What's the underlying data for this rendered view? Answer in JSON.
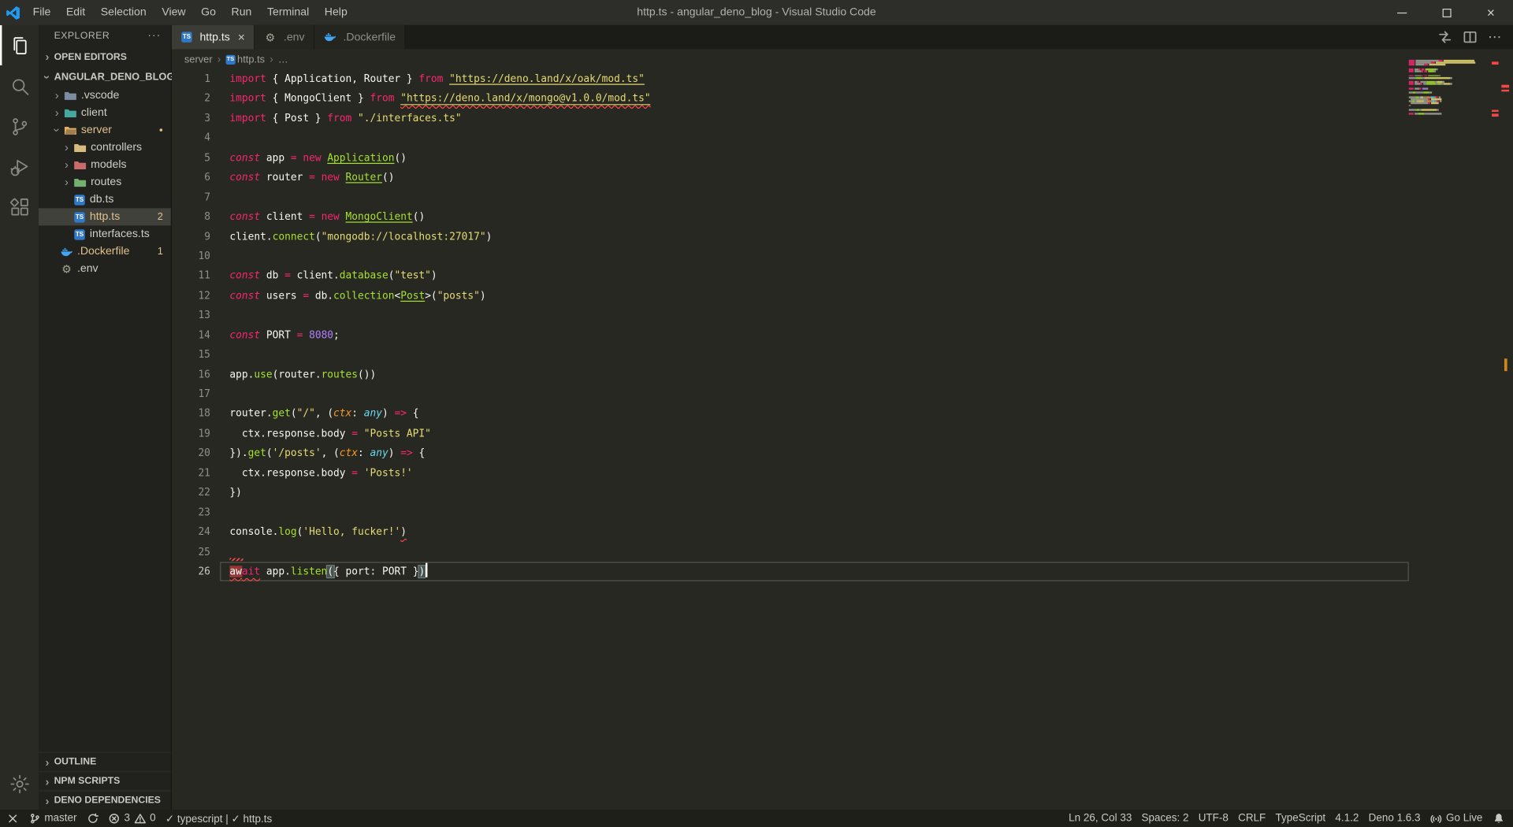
{
  "title_bar": {
    "menus": [
      "File",
      "Edit",
      "Selection",
      "View",
      "Go",
      "Run",
      "Terminal",
      "Help"
    ],
    "title": "http.ts - angular_deno_blog - Visual Studio Code",
    "window_controls": [
      "minimize",
      "maximize",
      "close"
    ]
  },
  "activity_bar": {
    "items": [
      {
        "name": "explorer",
        "active": true
      },
      {
        "name": "search",
        "active": false
      },
      {
        "name": "source-control",
        "active": false
      },
      {
        "name": "run-debug",
        "active": false
      },
      {
        "name": "extensions",
        "active": false
      }
    ],
    "bottom": [
      {
        "name": "settings",
        "active": false
      }
    ]
  },
  "explorer": {
    "title": "EXPLORER",
    "open_editors_label": "OPEN EDITORS",
    "workspace_label": "ANGULAR_DENO_BLOG",
    "tree": [
      {
        "label": ".vscode",
        "type": "folder",
        "color": "#7d8ca3",
        "indent": 1
      },
      {
        "label": "client",
        "type": "folder",
        "color": "#45a9a0",
        "indent": 1
      },
      {
        "label": "server",
        "type": "folder",
        "color": "#e0af68",
        "indent": 1,
        "open": true,
        "modified": true,
        "dot": true
      },
      {
        "label": "controllers",
        "type": "folder",
        "color": "#d7ba7d",
        "indent": 2
      },
      {
        "label": "models",
        "type": "folder",
        "color": "#cc6b6b",
        "indent": 2
      },
      {
        "label": "routes",
        "type": "folder",
        "color": "#74b06f",
        "indent": 2
      },
      {
        "label": "db.ts",
        "type": "ts",
        "indent": 2
      },
      {
        "label": "http.ts",
        "type": "ts",
        "indent": 2,
        "selected": true,
        "modified": true,
        "badge": "2"
      },
      {
        "label": "interfaces.ts",
        "type": "ts",
        "indent": 2
      },
      {
        "label": ".Dockerfile",
        "type": "docker",
        "indent": 1,
        "modified": true,
        "badge": "1"
      },
      {
        "label": ".env",
        "type": "env",
        "indent": 1
      }
    ],
    "bottom_sections": [
      "OUTLINE",
      "NPM SCRIPTS",
      "DENO DEPENDENCIES"
    ]
  },
  "tabs": [
    {
      "label": "http.ts",
      "icon": "ts",
      "active": true
    },
    {
      "label": ".env",
      "icon": "env",
      "active": false
    },
    {
      "label": ".Dockerfile",
      "icon": "docker",
      "active": false
    }
  ],
  "editor_actions": [
    {
      "name": "open-changes",
      "icon": "compare"
    },
    {
      "name": "split-editor",
      "icon": "split"
    },
    {
      "name": "more-actions",
      "icon": "more"
    }
  ],
  "breadcrumb": {
    "items": [
      {
        "label": "server"
      },
      {
        "label": "http.ts",
        "icon": "ts"
      },
      {
        "label": "…"
      }
    ]
  },
  "editor": {
    "cursor_line": 26,
    "cursor_position": "Ln 26, Col 33",
    "problem_lines": [
      2,
      24,
      26
    ],
    "lines": [
      {
        "n": 1,
        "tok": [
          [
            "k",
            "import"
          ],
          [
            "p",
            " { Application, Router } "
          ],
          [
            "k",
            "from"
          ],
          [
            "p",
            " "
          ],
          [
            "su",
            "\"https://deno.land/x/oak/mod.ts\""
          ]
        ]
      },
      {
        "n": 2,
        "tok": [
          [
            "k",
            "import"
          ],
          [
            "p",
            " { MongoClient } "
          ],
          [
            "k",
            "from"
          ],
          [
            "p",
            " "
          ],
          [
            "susq",
            "\"https://deno.land/x/mongo@v1.0.0/mod.ts\""
          ]
        ]
      },
      {
        "n": 3,
        "tok": [
          [
            "k",
            "import"
          ],
          [
            "p",
            " { Post } "
          ],
          [
            "k",
            "from"
          ],
          [
            "p",
            " "
          ],
          [
            "s",
            "\"./interfaces.ts\""
          ]
        ]
      },
      {
        "n": 4,
        "tok": []
      },
      {
        "n": 5,
        "tok": [
          [
            "c",
            "const"
          ],
          [
            "p",
            " app "
          ],
          [
            "k",
            "="
          ],
          [
            "p",
            " "
          ],
          [
            "k",
            "new"
          ],
          [
            "p",
            " "
          ],
          [
            "fu",
            "Application"
          ],
          [
            "p",
            "()"
          ]
        ]
      },
      {
        "n": 6,
        "tok": [
          [
            "c",
            "const"
          ],
          [
            "p",
            " router "
          ],
          [
            "k",
            "="
          ],
          [
            "p",
            " "
          ],
          [
            "k",
            "new"
          ],
          [
            "p",
            " "
          ],
          [
            "fu",
            "Router"
          ],
          [
            "p",
            "()"
          ]
        ]
      },
      {
        "n": 7,
        "tok": []
      },
      {
        "n": 8,
        "tok": [
          [
            "c",
            "const"
          ],
          [
            "p",
            " client "
          ],
          [
            "k",
            "="
          ],
          [
            "p",
            " "
          ],
          [
            "k",
            "new"
          ],
          [
            "p",
            " "
          ],
          [
            "fu",
            "MongoClient"
          ],
          [
            "p",
            "()"
          ]
        ]
      },
      {
        "n": 9,
        "tok": [
          [
            "p",
            "client."
          ],
          [
            "f",
            "connect"
          ],
          [
            "p",
            "("
          ],
          [
            "s",
            "\"mongodb://localhost:27017\""
          ],
          [
            "p",
            ")"
          ]
        ]
      },
      {
        "n": 10,
        "tok": []
      },
      {
        "n": 11,
        "tok": [
          [
            "c",
            "const"
          ],
          [
            "p",
            " db "
          ],
          [
            "k",
            "="
          ],
          [
            "p",
            " client."
          ],
          [
            "f",
            "database"
          ],
          [
            "p",
            "("
          ],
          [
            "s",
            "\"test\""
          ],
          [
            "p",
            ")"
          ]
        ]
      },
      {
        "n": 12,
        "tok": [
          [
            "c",
            "const"
          ],
          [
            "p",
            " users "
          ],
          [
            "k",
            "="
          ],
          [
            "p",
            " db."
          ],
          [
            "f",
            "collection"
          ],
          [
            "p",
            "<"
          ],
          [
            "fu",
            "Post"
          ],
          [
            "p",
            ">("
          ],
          [
            "s",
            "\"posts\""
          ],
          [
            "p",
            ")"
          ]
        ]
      },
      {
        "n": 13,
        "tok": []
      },
      {
        "n": 14,
        "tok": [
          [
            "c",
            "const"
          ],
          [
            "p",
            " PORT "
          ],
          [
            "k",
            "="
          ],
          [
            "p",
            " "
          ],
          [
            "n",
            "8080"
          ],
          [
            "p",
            ";"
          ]
        ]
      },
      {
        "n": 15,
        "tok": []
      },
      {
        "n": 16,
        "tok": [
          [
            "p",
            "app."
          ],
          [
            "f",
            "use"
          ],
          [
            "p",
            "(router."
          ],
          [
            "f",
            "routes"
          ],
          [
            "p",
            "())"
          ]
        ]
      },
      {
        "n": 17,
        "tok": []
      },
      {
        "n": 18,
        "tok": [
          [
            "p",
            "router."
          ],
          [
            "f",
            "get"
          ],
          [
            "p",
            "("
          ],
          [
            "s",
            "\"/\""
          ],
          [
            "p",
            ", ("
          ],
          [
            "pa",
            "ctx"
          ],
          [
            "p",
            ": "
          ],
          [
            "t",
            "any"
          ],
          [
            "p",
            ") "
          ],
          [
            "k",
            "=>"
          ],
          [
            "p",
            " {"
          ]
        ]
      },
      {
        "n": 19,
        "tok": [
          [
            "p",
            "  ctx.response.body "
          ],
          [
            "k",
            "="
          ],
          [
            "p",
            " "
          ],
          [
            "s",
            "\"Posts API\""
          ]
        ]
      },
      {
        "n": 20,
        "tok": [
          [
            "p",
            "})."
          ],
          [
            "f",
            "get"
          ],
          [
            "p",
            "("
          ],
          [
            "s",
            "'/posts'"
          ],
          [
            "p",
            ", ("
          ],
          [
            "pa",
            "ctx"
          ],
          [
            "p",
            ": "
          ],
          [
            "t",
            "any"
          ],
          [
            "p",
            ") "
          ],
          [
            "k",
            "=>"
          ],
          [
            "p",
            " {"
          ]
        ]
      },
      {
        "n": 21,
        "tok": [
          [
            "p",
            "  ctx.response.body "
          ],
          [
            "k",
            "="
          ],
          [
            "p",
            " "
          ],
          [
            "s",
            "'Posts!'"
          ]
        ]
      },
      {
        "n": 22,
        "tok": [
          [
            "p",
            "})"
          ]
        ]
      },
      {
        "n": 23,
        "tok": []
      },
      {
        "n": 24,
        "tok": [
          [
            "p",
            "console."
          ],
          [
            "f",
            "log"
          ],
          [
            "p",
            "("
          ],
          [
            "s",
            "'Hello, fucker!'"
          ],
          [
            "psq",
            ")"
          ]
        ]
      },
      {
        "n": 25,
        "tok": [
          [
            "wave",
            ""
          ]
        ]
      },
      {
        "n": 26,
        "tok": [
          [
            "kerr",
            "aw"
          ],
          [
            "ksq",
            "ait"
          ],
          [
            "p",
            " app."
          ],
          [
            "f",
            "listen"
          ],
          [
            "bm",
            "("
          ],
          [
            "p",
            "{ port: PORT }"
          ],
          [
            "bm",
            ")"
          ]
        ]
      }
    ]
  },
  "status_bar": {
    "left": [
      {
        "name": "remote",
        "icon": "x"
      },
      {
        "name": "git-branch",
        "icon": "branch",
        "label": "master"
      },
      {
        "name": "sync",
        "icon": "sync"
      },
      {
        "name": "problems",
        "errors": "3",
        "warnings": "0"
      },
      {
        "name": "extension-status",
        "label": "✓ typescript | ✓ http.ts"
      }
    ],
    "right": [
      {
        "name": "cursor-position",
        "label": "Ln 26, Col 33"
      },
      {
        "name": "indentation",
        "label": "Spaces: 2"
      },
      {
        "name": "encoding",
        "label": "UTF-8"
      },
      {
        "name": "eol",
        "label": "CRLF"
      },
      {
        "name": "language-mode",
        "label": "TypeScript"
      },
      {
        "name": "ts-version",
        "label": "4.1.2"
      },
      {
        "name": "deno-version",
        "label": "Deno 1.6.3"
      },
      {
        "name": "go-live",
        "icon": "broadcast",
        "label": "Go Live"
      },
      {
        "name": "notifications",
        "icon": "bell"
      }
    ]
  },
  "colors": {
    "accent_blue": "#1f9cf0",
    "keyword_pink": "#f92672",
    "string_yellow": "#e6db74",
    "green": "#a6e22e",
    "purple": "#ae81ff",
    "orange_param": "#fd971f",
    "cyan_type": "#66d9ef",
    "foreground": "#f8f8f2",
    "modified_gold": "#e2c08d",
    "error_red": "#f44747",
    "overview_orange": "#d18616",
    "editor_bg": "#272822",
    "sidebar_bg": "#21221d",
    "titlebar_bg": "#2d2d29",
    "statusbar_bg": "#1e1f19"
  }
}
